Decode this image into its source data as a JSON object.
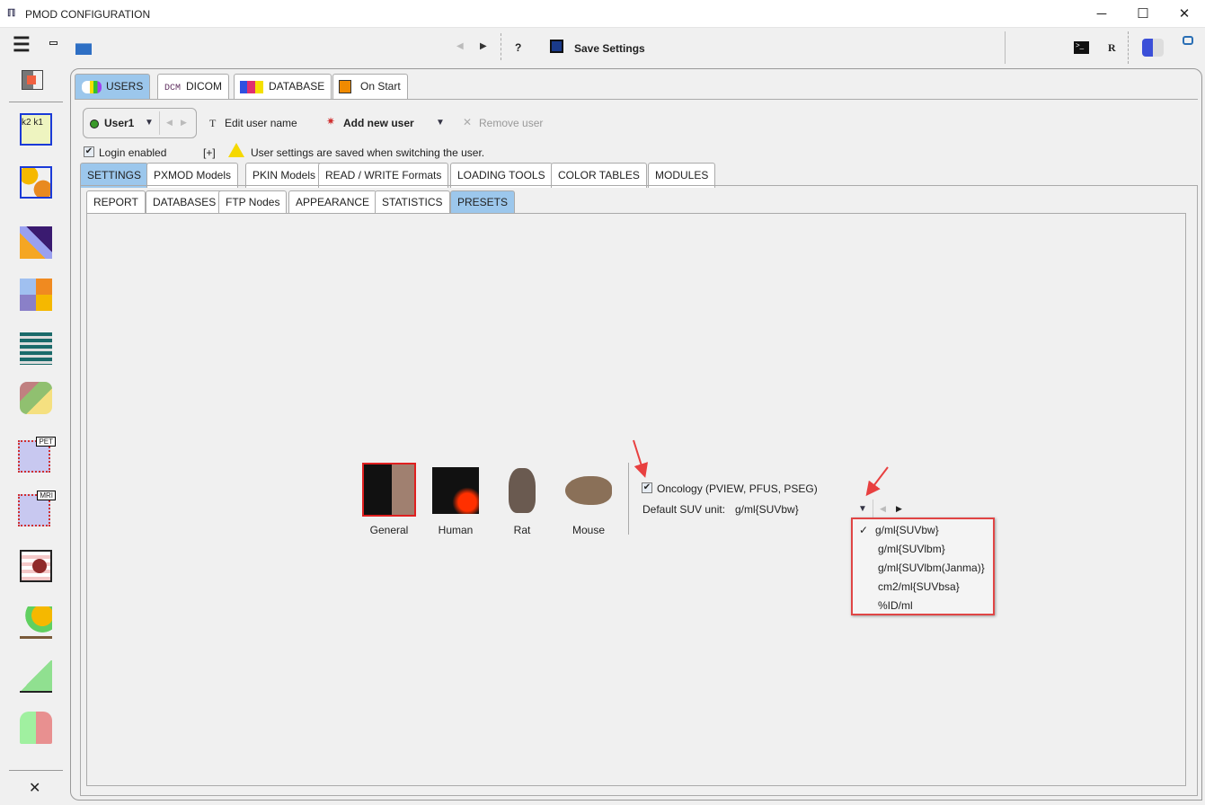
{
  "window": {
    "title": "PMOD CONFIGURATION",
    "app_icon": "pmod-logo-icon"
  },
  "toolbar": {
    "save_label": "Save Settings",
    "help_label": "?",
    "r_label": "R"
  },
  "main_tabs": [
    {
      "label": "USERS",
      "selected": true
    },
    {
      "label": "DICOM",
      "prefix": "DCM"
    },
    {
      "label": "DATABASE"
    },
    {
      "label": "On Start"
    }
  ],
  "user": {
    "current": "User1",
    "edit_label": "Edit user name",
    "add_label": "Add new user",
    "remove_label": "Remove user",
    "login_label": "Login enabled",
    "login_checked": true,
    "expand_label": "[+]",
    "warning": "User settings are saved when switching the user.",
    "status_color": "#3a9a2a"
  },
  "settings_tabs": [
    {
      "label": "SETTINGS",
      "selected": true
    },
    {
      "label": "PXMOD Models"
    },
    {
      "label": "PKIN Models"
    },
    {
      "label": "READ / WRITE Formats"
    },
    {
      "label": "LOADING TOOLS"
    },
    {
      "label": "COLOR TABLES"
    },
    {
      "label": "MODULES"
    }
  ],
  "sub_tabs": [
    {
      "label": "REPORT"
    },
    {
      "label": "DATABASES"
    },
    {
      "label": "FTP Nodes"
    },
    {
      "label": "APPEARANCE"
    },
    {
      "label": "STATISTICS"
    },
    {
      "label": "PRESETS",
      "selected": true
    }
  ],
  "presets": [
    {
      "label": "General",
      "selected": true
    },
    {
      "label": "Human"
    },
    {
      "label": "Rat"
    },
    {
      "label": "Mouse"
    }
  ],
  "oncology": {
    "label": "Oncology (PVIEW, PFUS, PSEG)",
    "checked": true
  },
  "suv": {
    "label": "Default SUV unit:",
    "value": "g/ml{SUVbw}",
    "options": [
      "g/ml{SUVbw}",
      "g/ml{SUVlbm}",
      "g/ml{SUVlbm(Janma)}",
      "cm2/ml{SUVbsa}",
      "%ID/ml"
    ],
    "check": "✓"
  },
  "sidebar": {
    "close_label": "✕",
    "pet_label": "PET",
    "mri_label": "MRI"
  },
  "colors": {
    "tab_selected": "#9cc7ec",
    "highlight_border": "#e04545"
  }
}
